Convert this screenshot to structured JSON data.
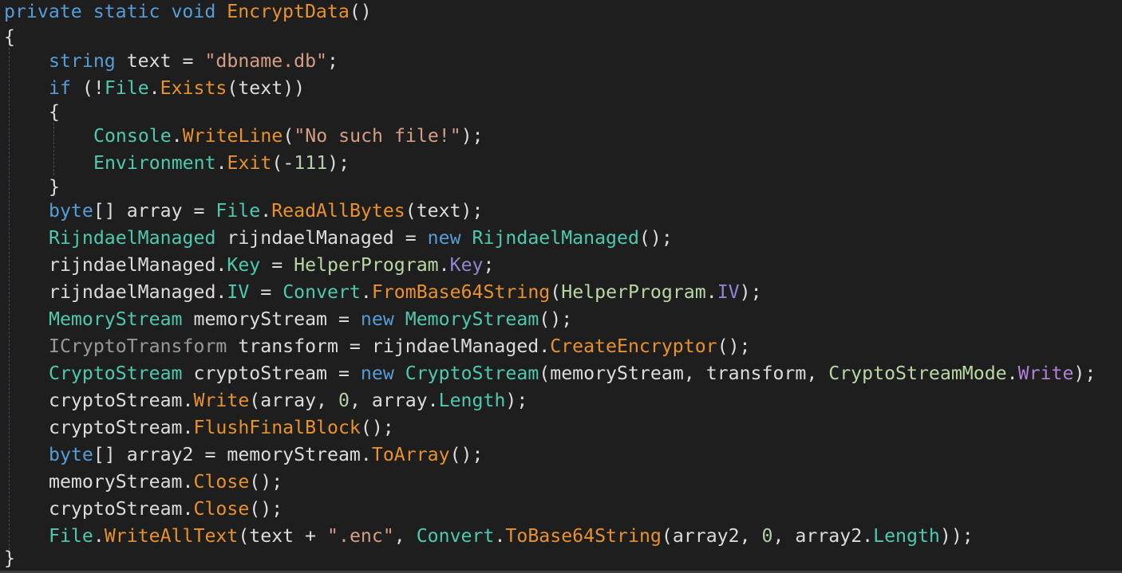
{
  "editor": {
    "colors": {
      "background": "#1e1e1e",
      "keyword": "#569cd6",
      "type": "#4ec9b0",
      "method": "#e8912d",
      "property": "#9085d3",
      "string": "#d69d85",
      "number": "#b5cea8",
      "text": "#dcdcdc"
    },
    "lines": [
      [
        [
          "kw",
          "private"
        ],
        [
          "plain",
          " "
        ],
        [
          "kw",
          "static"
        ],
        [
          "plain",
          " "
        ],
        [
          "kw",
          "void"
        ],
        [
          "plain",
          " "
        ],
        [
          "meth",
          "EncryptData"
        ],
        [
          "plain",
          "()"
        ]
      ],
      [
        [
          "plain",
          "{"
        ]
      ],
      [
        [
          "kw",
          "string"
        ],
        [
          "plain",
          " text = "
        ],
        [
          "str",
          "\"dbname.db\""
        ],
        [
          "plain",
          ";"
        ]
      ],
      [
        [
          "kw",
          "if"
        ],
        [
          "plain",
          " (!"
        ],
        [
          "typ",
          "File"
        ],
        [
          "plain",
          "."
        ],
        [
          "meth",
          "Exists"
        ],
        [
          "plain",
          "(text))"
        ]
      ],
      [
        [
          "plain",
          "{"
        ]
      ],
      [
        [
          "typ",
          "Console"
        ],
        [
          "plain",
          "."
        ],
        [
          "meth",
          "WriteLine"
        ],
        [
          "plain",
          "("
        ],
        [
          "str",
          "\"No such file!\""
        ],
        [
          "plain",
          ");"
        ]
      ],
      [
        [
          "typ",
          "Environment"
        ],
        [
          "plain",
          "."
        ],
        [
          "meth",
          "Exit"
        ],
        [
          "plain",
          "(-"
        ],
        [
          "num",
          "111"
        ],
        [
          "plain",
          ");"
        ]
      ],
      [
        [
          "plain",
          "}"
        ]
      ],
      [
        [
          "kw",
          "byte"
        ],
        [
          "plain",
          "[] array = "
        ],
        [
          "typ",
          "File"
        ],
        [
          "plain",
          "."
        ],
        [
          "meth",
          "ReadAllBytes"
        ],
        [
          "plain",
          "(text);"
        ]
      ],
      [
        [
          "typ",
          "RijndaelManaged"
        ],
        [
          "plain",
          " rijndaelManaged = "
        ],
        [
          "kw",
          "new"
        ],
        [
          "plain",
          " "
        ],
        [
          "typ",
          "RijndaelManaged"
        ],
        [
          "plain",
          "();"
        ]
      ],
      [
        [
          "plain",
          "rijndaelManaged."
        ],
        [
          "cprop",
          "Key"
        ],
        [
          "plain",
          " = "
        ],
        [
          "typl",
          "HelperProgram"
        ],
        [
          "plain",
          "."
        ],
        [
          "prop",
          "Key"
        ],
        [
          "plain",
          ";"
        ]
      ],
      [
        [
          "plain",
          "rijndaelManaged."
        ],
        [
          "cprop",
          "IV"
        ],
        [
          "plain",
          " = "
        ],
        [
          "typ",
          "Convert"
        ],
        [
          "plain",
          "."
        ],
        [
          "meth",
          "FromBase64String"
        ],
        [
          "plain",
          "("
        ],
        [
          "typl",
          "HelperProgram"
        ],
        [
          "plain",
          "."
        ],
        [
          "prop",
          "IV"
        ],
        [
          "plain",
          ");"
        ]
      ],
      [
        [
          "typ",
          "MemoryStream"
        ],
        [
          "plain",
          " memoryStream = "
        ],
        [
          "kw",
          "new"
        ],
        [
          "plain",
          " "
        ],
        [
          "typ",
          "MemoryStream"
        ],
        [
          "plain",
          "();"
        ]
      ],
      [
        [
          "ifc",
          "ICryptoTransform"
        ],
        [
          "plain",
          " transform = rijndaelManaged."
        ],
        [
          "meth",
          "CreateEncryptor"
        ],
        [
          "plain",
          "();"
        ]
      ],
      [
        [
          "typ",
          "CryptoStream"
        ],
        [
          "plain",
          " cryptoStream = "
        ],
        [
          "kw",
          "new"
        ],
        [
          "plain",
          " "
        ],
        [
          "typ",
          "CryptoStream"
        ],
        [
          "plain",
          "(memoryStream, transform, "
        ],
        [
          "enm",
          "CryptoStreamMode"
        ],
        [
          "plain",
          "."
        ],
        [
          "enmv",
          "Write"
        ],
        [
          "plain",
          ");"
        ]
      ],
      [
        [
          "plain",
          "cryptoStream."
        ],
        [
          "meth",
          "Write"
        ],
        [
          "plain",
          "(array, "
        ],
        [
          "num",
          "0"
        ],
        [
          "plain",
          ", array."
        ],
        [
          "cprop",
          "Length"
        ],
        [
          "plain",
          ");"
        ]
      ],
      [
        [
          "plain",
          "cryptoStream."
        ],
        [
          "meth",
          "FlushFinalBlock"
        ],
        [
          "plain",
          "();"
        ]
      ],
      [
        [
          "kw",
          "byte"
        ],
        [
          "plain",
          "[] array2 = memoryStream."
        ],
        [
          "meth",
          "ToArray"
        ],
        [
          "plain",
          "();"
        ]
      ],
      [
        [
          "plain",
          "memoryStream."
        ],
        [
          "meth",
          "Close"
        ],
        [
          "plain",
          "();"
        ]
      ],
      [
        [
          "plain",
          "cryptoStream."
        ],
        [
          "meth",
          "Close"
        ],
        [
          "plain",
          "();"
        ]
      ],
      [
        [
          "typ",
          "File"
        ],
        [
          "plain",
          "."
        ],
        [
          "meth",
          "WriteAllText"
        ],
        [
          "plain",
          "(text + "
        ],
        [
          "str",
          "\".enc\""
        ],
        [
          "plain",
          ", "
        ],
        [
          "typ",
          "Convert"
        ],
        [
          "plain",
          "."
        ],
        [
          "meth",
          "ToBase64String"
        ],
        [
          "plain",
          "(array2, "
        ],
        [
          "num",
          "0"
        ],
        [
          "plain",
          ", array2."
        ],
        [
          "cprop",
          "Length"
        ],
        [
          "plain",
          "));"
        ]
      ],
      [
        [
          "plain",
          "}"
        ]
      ]
    ]
  }
}
